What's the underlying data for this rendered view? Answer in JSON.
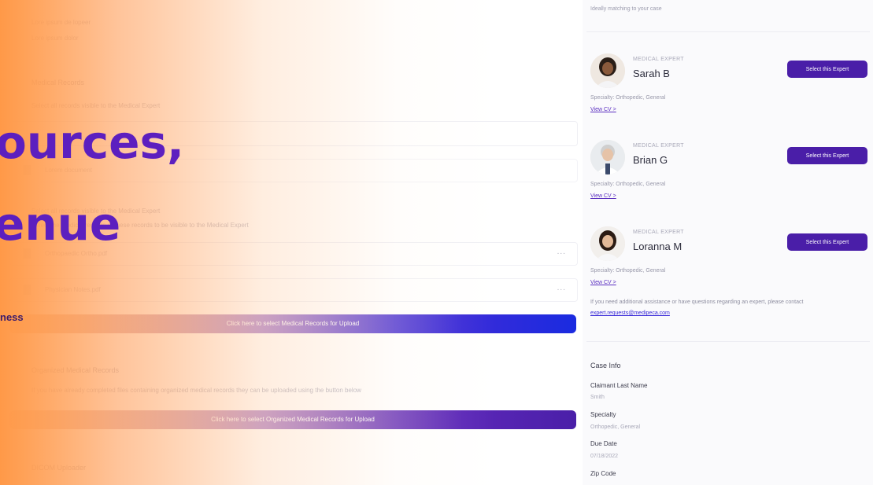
{
  "left": {
    "faint_lines": [
      "Lore ipsum de lopeer",
      "Lore ipsum dolor"
    ],
    "sections": {
      "medical_records": {
        "title": "Medical Records",
        "description": "Select all records visible to the Medical Expert",
        "sub_title": "Select all records visible to the Medical Expert",
        "sub_description": "Select the medical records of these records to be visible to the Medical Expert",
        "files": [
          {
            "name": "Lorem document"
          },
          {
            "name": "Orthopaedic Ortho.pdf",
            "menu": "..."
          },
          {
            "name": "Physician Notes.pdf",
            "menu": "..."
          }
        ],
        "upload_button": "Click here to select Medical Records for Upload"
      },
      "organized_records": {
        "title": "Organized Medical Records",
        "description": "If you have already completed files containing organized medical records they can be uploaded using the button below",
        "upload_button": "Click here to select Organized Medical Records for Upload"
      },
      "dicom": {
        "title": "DICOM Uploader"
      }
    },
    "headline_line1": "ources,",
    "headline_line2": "enue",
    "tagline": "ness"
  },
  "right": {
    "top_note": "Ideally matching to your case",
    "experts": [
      {
        "role": "MEDICAL EXPERT",
        "name": "Sarah B",
        "button": "Select this Expert",
        "specialty": "Specialty: Orthopedic, General",
        "cv": "View CV >"
      },
      {
        "role": "MEDICAL EXPERT",
        "name": "Brian G",
        "button": "Select this Expert",
        "specialty": "Specialty: Orthopedic, General",
        "cv": "View CV >"
      },
      {
        "role": "MEDICAL EXPERT",
        "name": "Loranna M",
        "button": "Select this Expert",
        "specialty": "Specialty: Orthopedic, General",
        "cv": "View CV >"
      }
    ],
    "help": {
      "text": "If you need additional assistance or have questions regarding an expert, please contact",
      "email": "expert.requests@medipeca.com"
    },
    "case_info": {
      "title": "Case Info",
      "fields": [
        {
          "label": "Claimant Last Name",
          "value": "Smith"
        },
        {
          "label": "Specialty",
          "value": "Orthopedic, General"
        },
        {
          "label": "Due Date",
          "value": "07/18/2022"
        },
        {
          "label": "Zip Code",
          "value": ""
        }
      ]
    }
  },
  "colors": {
    "brand_purple": "#5c1fbf",
    "button_purple": "#4a1ea8",
    "accent_orange": "#ff9948"
  }
}
